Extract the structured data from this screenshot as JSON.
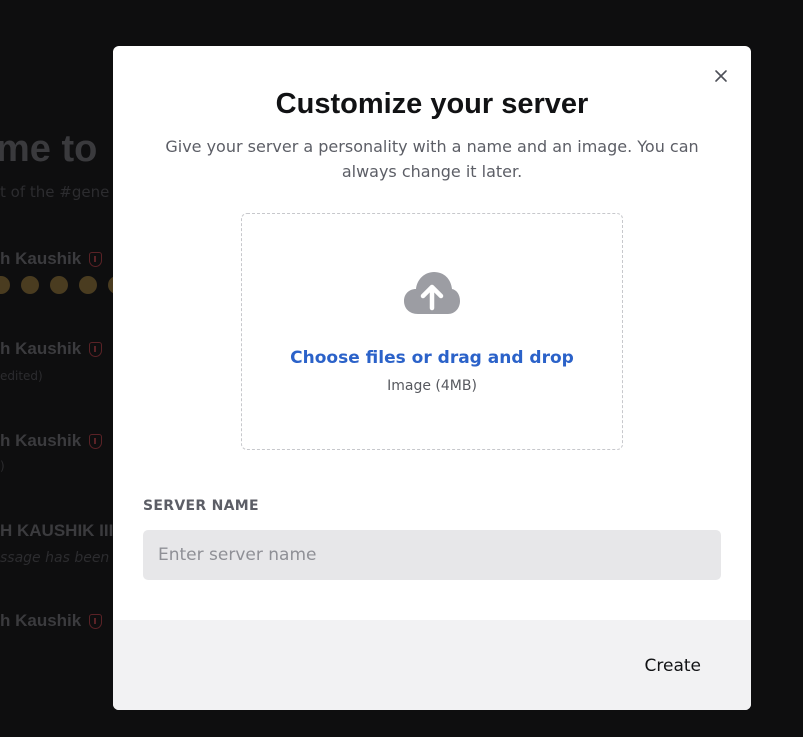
{
  "background": {
    "welcome_heading": "me to",
    "welcome_sub": "t of the #gene",
    "messages": [
      {
        "author": "h Kaushik",
        "line": ""
      },
      {
        "author": "h Kaushik",
        "line": "edited)"
      },
      {
        "author": "h Kaushik",
        "line": ")"
      },
      {
        "author": "H KAUSHIK III",
        "line": "ssage has been d"
      },
      {
        "author": "h Kaushik",
        "line": ""
      }
    ]
  },
  "modal": {
    "title": "Customize your server",
    "description": "Give your server a personality with a name and an image. You can always change it later.",
    "upload": {
      "link_text": "Choose files or drag and drop",
      "hint": "Image (4MB)"
    },
    "server_name": {
      "label": "SERVER NAME",
      "placeholder": "Enter server name",
      "value": ""
    },
    "create_label": "Create"
  },
  "colors": {
    "backdrop": "#0e0e0f",
    "modal_bg": "#ffffff",
    "link": "#2b62c9",
    "footer_bg": "#f2f2f3",
    "input_bg": "#e7e7e9"
  }
}
